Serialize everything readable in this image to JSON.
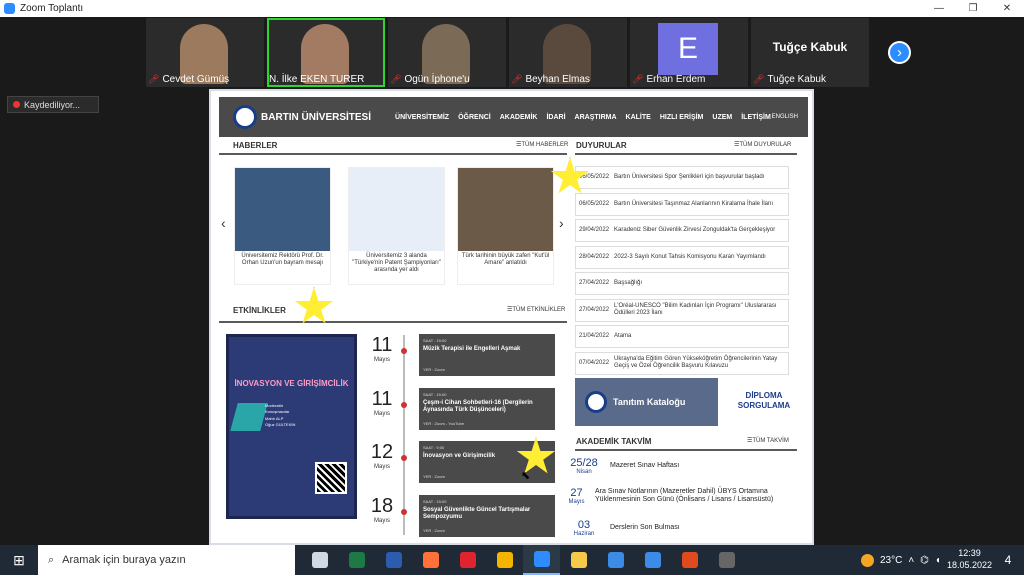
{
  "window": {
    "title": "Zoom Toplantı",
    "controls": [
      "—",
      "❐",
      "✕"
    ]
  },
  "participants": [
    {
      "name": "Cevdet Gümüş",
      "muted": true,
      "type": "video",
      "skin": "#9c7a5e"
    },
    {
      "name": "N. İlke EKEN TURER",
      "muted": false,
      "type": "video",
      "active": true,
      "skin": "#a37b62"
    },
    {
      "name": "Ogün İphone'u",
      "muted": true,
      "type": "video",
      "skin": "#7b6a55"
    },
    {
      "name": "Beyhan Elmas",
      "muted": true,
      "type": "video",
      "skin": "#5a4a3e"
    },
    {
      "name": "Erhan Erdem",
      "muted": true,
      "type": "letter",
      "letter": "E"
    },
    {
      "name": "Tuğçe Kabuk",
      "muted": true,
      "type": "name",
      "display": "Tuğçe Kabuk"
    }
  ],
  "recording": "Kaydediliyor...",
  "site": {
    "logo": "BARTIN ÜNİVERSİTESİ",
    "nav": [
      "ÜNİVERSİTEMİZ",
      "ÖĞRENCİ",
      "AKADEMİK",
      "İDARİ",
      "ARAŞTIRMA",
      "KALİTE",
      "HIZLI ERİŞİM",
      "UZEM",
      "İLETİŞİM"
    ],
    "english": "ENGLISH",
    "news": {
      "title": "HABERLER",
      "link": "☰TÜM HABERLER",
      "items": [
        {
          "caption": "Üniversitemiz Rektörü Prof. Dr. Orhan Uzun'un bayram mesajı",
          "color": "#3a5a80"
        },
        {
          "caption": "Üniversitemiz 3 alanda \"Türkiye'nin Patent Şampiyonları\" arasında yer aldı",
          "color": "#e8eef8"
        },
        {
          "caption": "Türk tarihinin büyük zaferi \"Kut'ül Amare\" anlatıldı",
          "color": "#6b5a48"
        }
      ]
    },
    "announcements": {
      "title": "DUYURULAR",
      "link": "☰TÜM DUYURULAR",
      "items": [
        {
          "date": "06/05/2022",
          "text": "Bartın Üniversitesi Spor Şenlikleri için başvurular başladı"
        },
        {
          "date": "06/05/2022",
          "text": "Bartın Üniversitesi Taşınmaz Alanlarının Kiralama İhale İlanı"
        },
        {
          "date": "29/04/2022",
          "text": "Karadeniz Siber Güvenlik Zirvesi Zonguldak'ta Gerçekleşiyor"
        },
        {
          "date": "28/04/2022",
          "text": "2022-3 Sayılı Konut Tahsis Komisyonu Kararı Yayımlandı"
        },
        {
          "date": "27/04/2022",
          "text": "Başsağlığı"
        },
        {
          "date": "27/04/2022",
          "text": "L'Oréal-UNESCO \"Bilim Kadınları İçin Programı\" Uluslararası Ödülleri 2023 İlanı"
        },
        {
          "date": "21/04/2022",
          "text": "Atama"
        },
        {
          "date": "07/04/2022",
          "text": "Ukrayna'da Eğitim Gören Yükseköğretim Öğrencilerinin Yatay Geçiş ve Özel Öğrencilik Başvuru Kılavuzu"
        }
      ]
    },
    "events": {
      "title": "ETKİNLİKLER",
      "link": "☰TÜM ETKİNLİKLER",
      "poster": {
        "title": "İNOVASYON VE GİRİŞİMCİLİK",
        "lines": [
          "Moderatör",
          "Konuşmacılar",
          "Mahir ALP",
          "Oğuz GÜLTEKİN"
        ]
      },
      "items": [
        {
          "day": "11",
          "month": "Mayıs",
          "time": "SAAT : 15:00",
          "title": "Müzik Terapisi ile Engelleri Aşmak",
          "place": "YER : Zoom"
        },
        {
          "day": "11",
          "month": "Mayıs",
          "time": "SAAT : 15:00",
          "title": "Çeşm-i Cihan Sohbetleri-16 (Dergilerin Aynasında Türk Düşünceleri)",
          "place": "YER : Zoom - YouTube"
        },
        {
          "day": "12",
          "month": "Mayıs",
          "time": "SAAT : 9:00",
          "title": "İnovasyon ve Girişimcilik",
          "place": "YER : Zoom"
        },
        {
          "day": "18",
          "month": "Mayıs",
          "time": "SAAT : 15:00",
          "title": "Sosyal Güvenlikte Güncel Tartışmalar Sempozyumu",
          "place": "YER : Zoom"
        }
      ]
    },
    "catalog": "Tanıtım Kataloğu",
    "diploma": "DİPLOMA SORGULAMA",
    "calendar": {
      "title": "AKADEMİK TAKVİM",
      "link": "☰TÜM TAKVİM",
      "items": [
        {
          "date": "25/28",
          "month": "Nisan",
          "text": "Mazeret Sınav Haftası"
        },
        {
          "date": "27",
          "month": "Mayıs",
          "text": "Ara Sınav Notlarının (Mazeretler Dahil) ÜBYS Ortamına Yüklenmesinin Son Günü (Önlisans / Lisans / Lisansüstü)"
        },
        {
          "date": "03",
          "month": "Haziran",
          "text": "Derslerin Son Bulması"
        }
      ]
    }
  },
  "taskbar": {
    "search_placeholder": "Aramak için buraya yazın",
    "apps": [
      {
        "icon": "task-view-icon",
        "color": "#cfd8e3"
      },
      {
        "icon": "excel-icon",
        "color": "#1d7a45"
      },
      {
        "icon": "word-icon",
        "color": "#2b5cad"
      },
      {
        "icon": "firefox-icon",
        "color": "#ff7139"
      },
      {
        "icon": "opera-icon",
        "color": "#e0242f"
      },
      {
        "icon": "chrome-icon",
        "color": "#f4b400"
      },
      {
        "icon": "zoom-icon",
        "color": "#2d8cff",
        "active": true
      },
      {
        "icon": "file-explorer-icon",
        "color": "#f7c948"
      },
      {
        "icon": "store-icon",
        "color": "#3c8ce7"
      },
      {
        "icon": "mail-icon",
        "color": "#3c8ce7"
      },
      {
        "icon": "office-icon",
        "color": "#e04a1f"
      },
      {
        "icon": "calculator-icon",
        "color": "#666"
      }
    ],
    "weather": "23°C",
    "time": "12:39",
    "date": "18.05.2022",
    "notifications": "4"
  }
}
